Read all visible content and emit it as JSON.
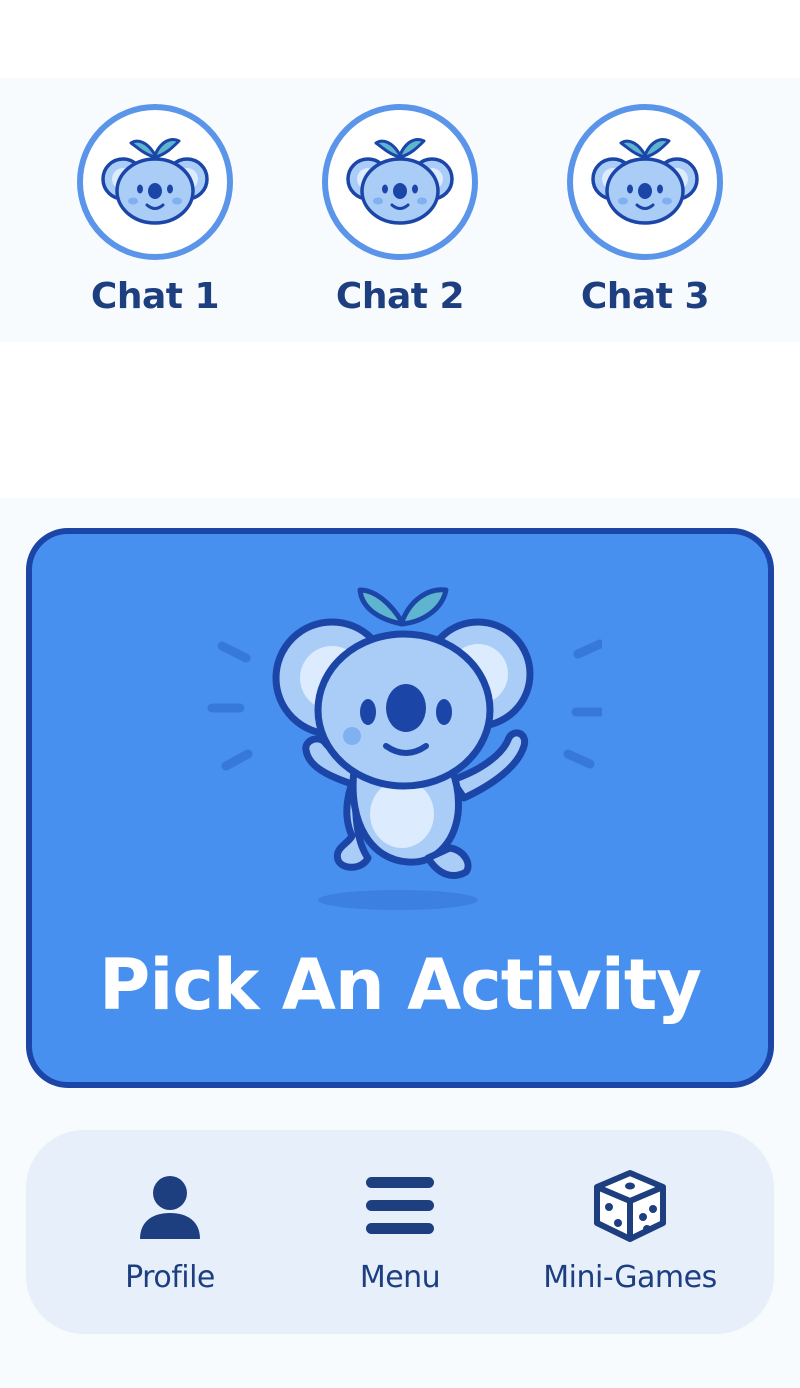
{
  "chats": [
    {
      "label": "Chat 1",
      "icon": "koala-icon"
    },
    {
      "label": "Chat 2",
      "icon": "koala-icon"
    },
    {
      "label": "Chat 3",
      "icon": "koala-icon"
    }
  ],
  "activity_card": {
    "title": "Pick An Activity",
    "icon": "dancing-koala-icon"
  },
  "bottom_nav": {
    "items": [
      {
        "label": "Profile",
        "icon": "user-icon"
      },
      {
        "label": "Menu",
        "icon": "hamburger-menu-icon"
      },
      {
        "label": "Mini-Games",
        "icon": "dice-icon"
      }
    ]
  },
  "colors": {
    "accent_blue": "#4890ef",
    "dark_blue": "#1b46a8",
    "text_navy": "#1d3f80",
    "koala_light": "#a9cdf7",
    "leaf_teal": "#5fb4d0",
    "nav_background": "#e7effb"
  }
}
